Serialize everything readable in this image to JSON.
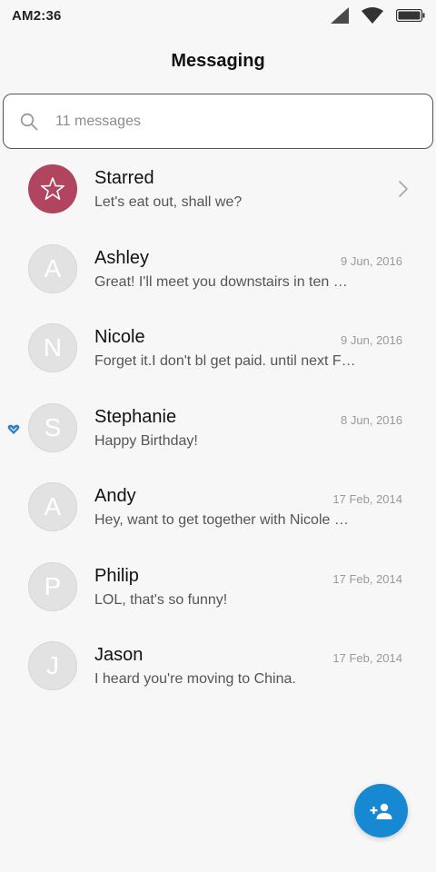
{
  "status_bar": {
    "time": "AM2:36",
    "icons": [
      "signal-icon",
      "wifi-icon",
      "battery-icon"
    ]
  },
  "header": {
    "title": "Messaging"
  },
  "search": {
    "placeholder": "11 messages",
    "icon": "search-icon"
  },
  "conversations": [
    {
      "name": "Starred",
      "preview": "Let's eat out, shall we?",
      "date": "",
      "avatar": "star-icon",
      "avatar_color": "#b14560"
    },
    {
      "name": "Ashley",
      "preview": "Great! I'll meet you downstairs in ten …",
      "date": "9 Jun, 2016",
      "avatar": "A"
    },
    {
      "name": "Nicole",
      "preview": "Forget it.I don't bl get paid. until next F…",
      "date": "9 Jun, 2016",
      "avatar": "N"
    },
    {
      "name": "Stephanie",
      "preview": "Happy Birthday!",
      "date": "8 Jun, 2016",
      "avatar": "S",
      "marker": "heart-icon"
    },
    {
      "name": "Andy",
      "preview": "Hey, want to get together with Nicole …",
      "date": "17 Feb, 2014",
      "avatar": "A"
    },
    {
      "name": "Philip",
      "preview": "LOL, that's so funny!",
      "date": "17 Feb, 2014",
      "avatar": "P"
    },
    {
      "name": "Jason",
      "preview": "I heard you're moving to China.",
      "date": "17 Feb, 2014",
      "avatar": "J"
    }
  ],
  "fab": {
    "icon": "add-contact-icon",
    "color": "#1789d2"
  },
  "colors": {
    "background": "#f7f7f7",
    "accent": "#1789d2",
    "starred": "#b14560"
  }
}
